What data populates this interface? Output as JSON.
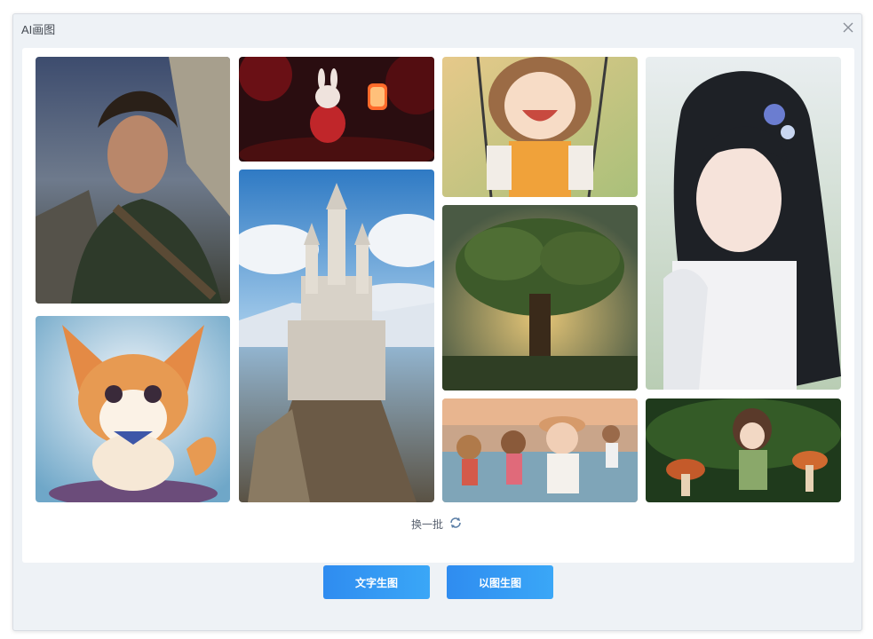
{
  "dialog": {
    "title": "AI画图",
    "close_icon": "close-icon"
  },
  "gallery": {
    "images": [
      {
        "name": "warrior-portrait",
        "desc": "young warrior in green cloak"
      },
      {
        "name": "rabbit-lantern",
        "desc": "red rabbit with lantern"
      },
      {
        "name": "swing-girl",
        "desc": "laughing girl on swing"
      },
      {
        "name": "flower-hair-girl",
        "desc": "girl with long dark hair and flowers"
      },
      {
        "name": "corgi-puppy",
        "desc": "cartoon corgi puppy"
      },
      {
        "name": "fantasy-castle",
        "desc": "white castle on cliff"
      },
      {
        "name": "great-tree",
        "desc": "large tree at sunset"
      },
      {
        "name": "beach-girls",
        "desc": "girls running on beach"
      },
      {
        "name": "mushroom-girl",
        "desc": "girl among mushrooms in forest"
      }
    ],
    "refresh_label": "换一批",
    "refresh_icon": "refresh-icon"
  },
  "actions": {
    "text_to_image": "文字生图",
    "image_to_image": "以图生图"
  },
  "colors": {
    "accent": "#2f8cf0",
    "dialog_bg": "#eef2f6"
  }
}
